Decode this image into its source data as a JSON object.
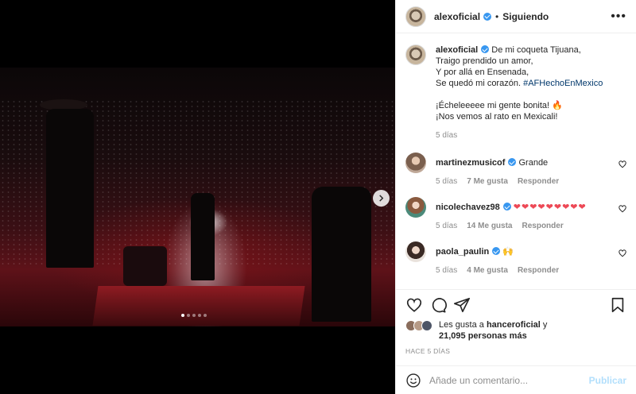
{
  "post": {
    "author": "alexoficial",
    "follow_status": "Siguiendo",
    "more_icon": "more-options-icon"
  },
  "caption": {
    "username": "alexoficial",
    "lines": [
      "De mi coqueta Tijuana,",
      "Traigo prendido un amor,",
      "Y por allá en Ensenada,",
      "Se quedó mi corazón."
    ],
    "hashtag": "#AFHechoEnMexico",
    "lines2": [
      "¡Écheleeeee mi gente bonita! 🔥",
      "¡Nos vemos al rato en Mexicali!"
    ],
    "time": "5 días"
  },
  "comments": [
    {
      "username": "martinezmusicof",
      "text": "Grande",
      "time": "5 días",
      "likes": "7 Me gusta",
      "reply": "Responder"
    },
    {
      "username": "nicolechavez98",
      "text": "❤❤❤❤❤❤❤❤❤",
      "time": "5 días",
      "likes": "14 Me gusta",
      "reply": "Responder"
    },
    {
      "username": "paola_paulin",
      "text": "🙌",
      "time": "5 días",
      "likes": "4 Me gusta",
      "reply": "Responder"
    }
  ],
  "likes": {
    "prefix": "Les gusta a",
    "user": "hanceroficial",
    "conj": "y",
    "count": "21,095 personas más"
  },
  "posted": "HACE 5 DÍAS",
  "composer": {
    "placeholder": "Añade un comentario...",
    "publish": "Publicar"
  },
  "carousel": {
    "slides": 5,
    "active": 1
  },
  "colors": {
    "verified": "#3897f0",
    "link": "#00376b",
    "publish_disabled": "#b2dffc",
    "heart": "#ed4956"
  }
}
